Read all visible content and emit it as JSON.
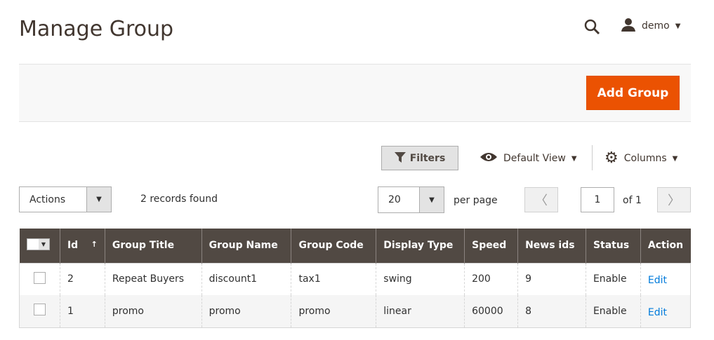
{
  "header": {
    "title": "Manage Group",
    "user": "demo"
  },
  "actions": {
    "add_label": "Add Group"
  },
  "toolbar": {
    "filters": "Filters",
    "default_view": "Default View",
    "columns": "Columns"
  },
  "grid": {
    "actions": "Actions",
    "records": "2 records found",
    "per_page_value": "20",
    "per_page_label": "per page",
    "page": "1",
    "of": "of 1"
  },
  "table": {
    "headers": [
      "Id",
      "Group Title",
      "Group Name",
      "Group Code",
      "Display Type",
      "Speed",
      "News ids",
      "Status",
      "Action"
    ],
    "sort_indicator": "↑",
    "rows": [
      [
        "2",
        "Repeat Buyers",
        "discount1",
        "tax1",
        "swing",
        "200",
        "9",
        "Enable",
        "Edit"
      ],
      [
        "1",
        "promo",
        "promo",
        "promo",
        "linear",
        "60000",
        "8",
        "Enable",
        "Edit"
      ]
    ]
  },
  "colors": {
    "accent": "#eb5202",
    "header_bg": "#514943",
    "link": "#007bdb"
  }
}
